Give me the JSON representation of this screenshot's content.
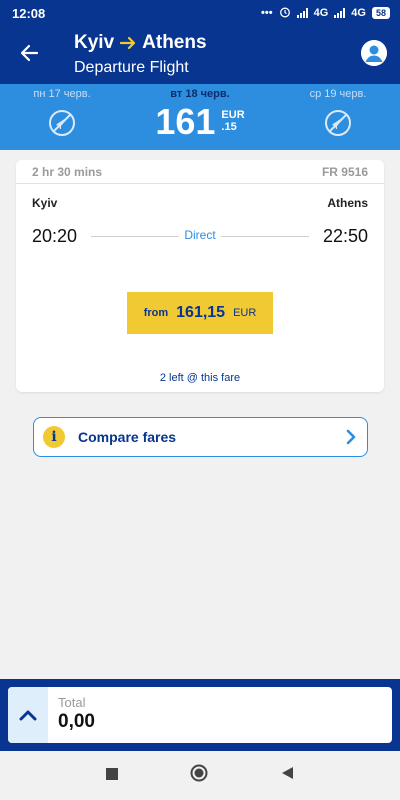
{
  "status_bar": {
    "time": "12:08",
    "network_1": "4G",
    "network_2": "4G",
    "battery": "58"
  },
  "header": {
    "origin": "Kyiv",
    "destination": "Athens",
    "subtitle": "Departure Flight"
  },
  "date_strip": {
    "prev_date": "пн 17 черв.",
    "selected_date": "вт 18 черв.",
    "next_date": "ср 19 черв.",
    "price_integer": "161",
    "price_currency": "EUR",
    "price_decimal": ".15"
  },
  "flight": {
    "duration": "2 hr 30 mins",
    "flight_number": "FR 9516",
    "origin_city": "Kyiv",
    "destination_city": "Athens",
    "departure_time": "20:20",
    "arrival_time": "22:50",
    "stops": "Direct",
    "fare_prefix": "from",
    "fare_amount": "161,15",
    "fare_currency": "EUR",
    "availability": "2 left @ this fare"
  },
  "compare": {
    "label": "Compare fares"
  },
  "total": {
    "label": "Total",
    "value": "0,00"
  },
  "colors": {
    "primary": "#073590",
    "accent_yellow": "#f1c933",
    "date_strip": "#2d8ee0",
    "background": "#f1f1f1"
  }
}
